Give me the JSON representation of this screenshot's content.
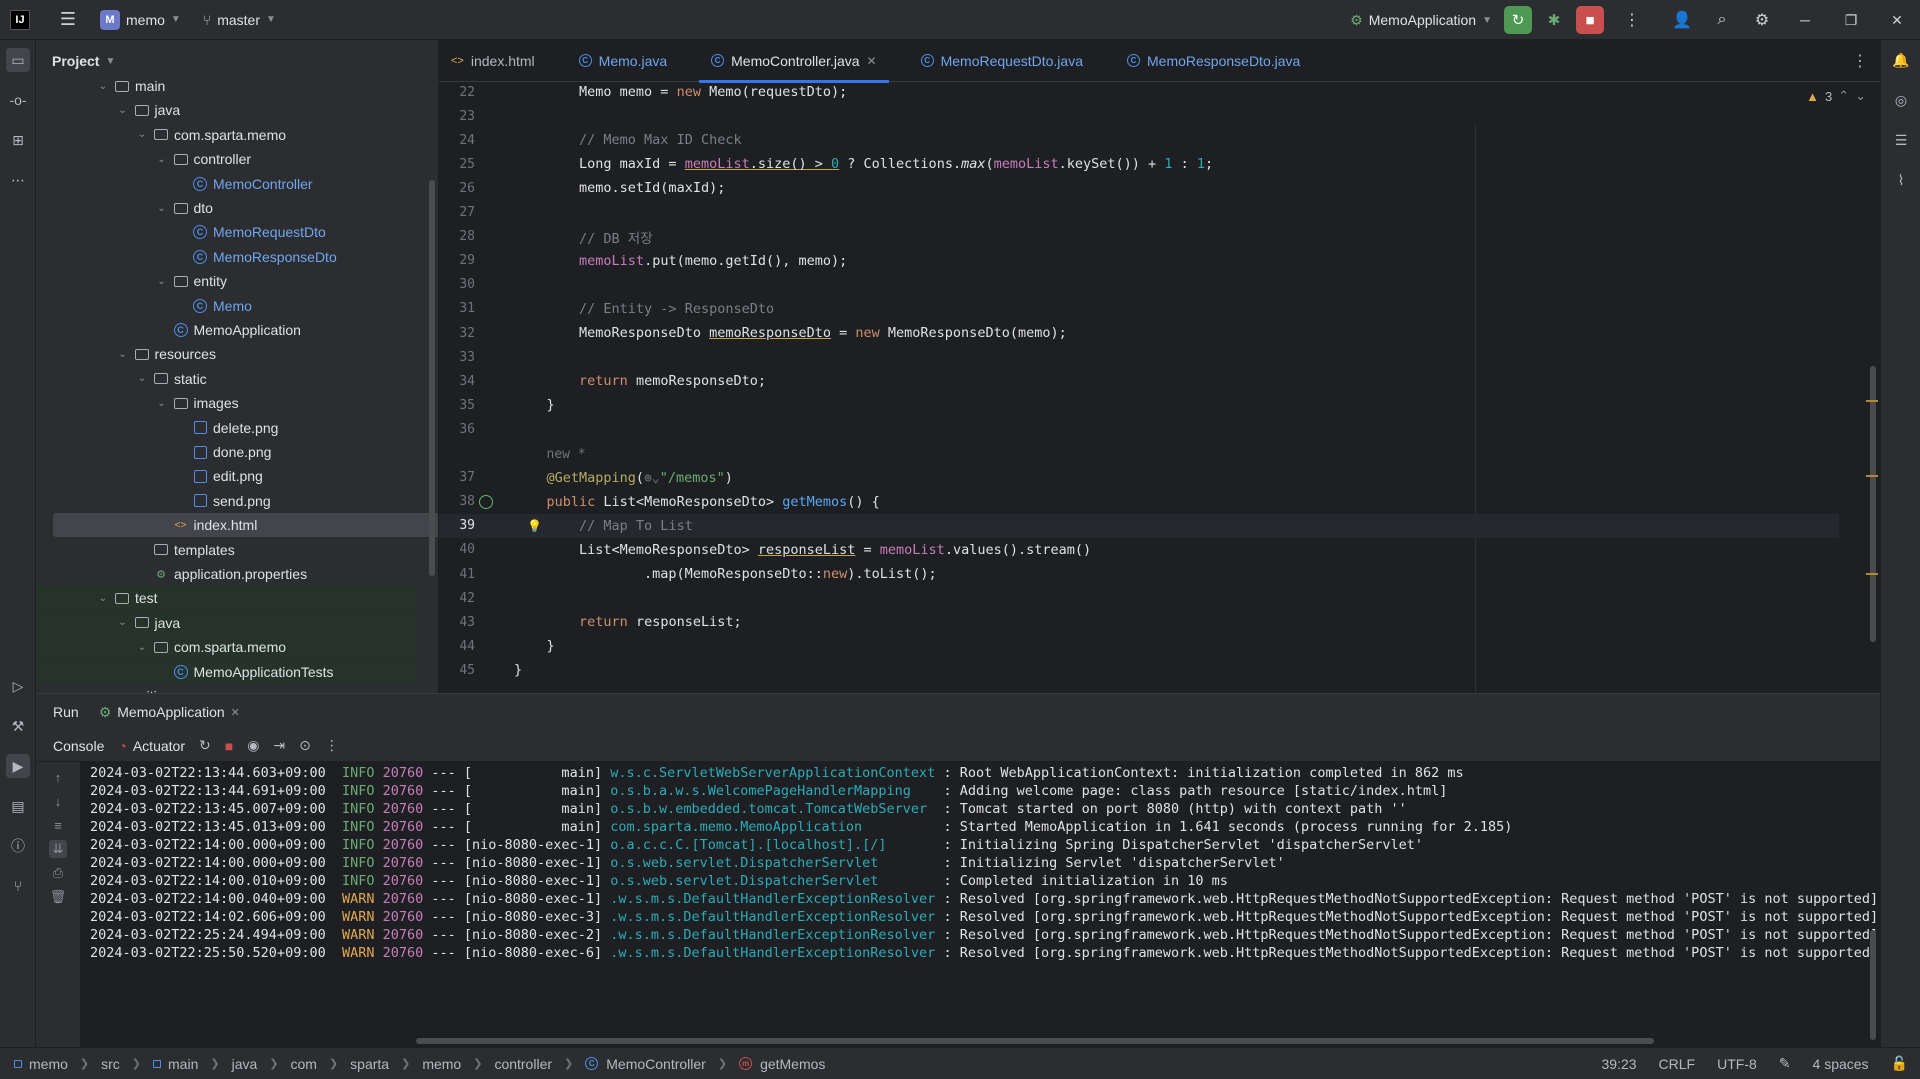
{
  "titlebar": {
    "logo": "IJ",
    "project_badge": "M",
    "project_name": "memo",
    "branch": "master",
    "run_config": "MemoApplication"
  },
  "project_panel": {
    "title": "Project",
    "tree": [
      {
        "label": "main",
        "kind": "folder",
        "indent": 0,
        "open": true
      },
      {
        "label": "java",
        "kind": "folder",
        "indent": 1,
        "open": true
      },
      {
        "label": "com.sparta.memo",
        "kind": "package",
        "indent": 2,
        "open": true
      },
      {
        "label": "controller",
        "kind": "package",
        "indent": 3,
        "open": true
      },
      {
        "label": "MemoController",
        "kind": "class",
        "indent": 4
      },
      {
        "label": "dto",
        "kind": "package",
        "indent": 3,
        "open": true
      },
      {
        "label": "MemoRequestDto",
        "kind": "class",
        "indent": 4
      },
      {
        "label": "MemoResponseDto",
        "kind": "class",
        "indent": 4
      },
      {
        "label": "entity",
        "kind": "package",
        "indent": 3,
        "open": true
      },
      {
        "label": "Memo",
        "kind": "class",
        "indent": 4
      },
      {
        "label": "MemoApplication",
        "kind": "appclass",
        "indent": 3
      },
      {
        "label": "resources",
        "kind": "folder",
        "indent": 1,
        "open": true
      },
      {
        "label": "static",
        "kind": "folder",
        "indent": 2,
        "open": true
      },
      {
        "label": "images",
        "kind": "folder",
        "indent": 3,
        "open": true
      },
      {
        "label": "delete.png",
        "kind": "image",
        "indent": 4
      },
      {
        "label": "done.png",
        "kind": "image",
        "indent": 4
      },
      {
        "label": "edit.png",
        "kind": "image",
        "indent": 4
      },
      {
        "label": "send.png",
        "kind": "image",
        "indent": 4
      },
      {
        "label": "index.html",
        "kind": "html",
        "indent": 3,
        "selected": true
      },
      {
        "label": "templates",
        "kind": "folder",
        "indent": 2
      },
      {
        "label": "application.properties",
        "kind": "props",
        "indent": 2
      },
      {
        "label": "test",
        "kind": "folder",
        "indent": 0,
        "open": true,
        "test": true
      },
      {
        "label": "java",
        "kind": "folder",
        "indent": 1,
        "open": true,
        "test": true
      },
      {
        "label": "com.sparta.memo",
        "kind": "package",
        "indent": 2,
        "open": true,
        "test": true
      },
      {
        "label": "MemoApplicationTests",
        "kind": "class",
        "indent": 3,
        "test": true
      },
      {
        "label": ".gitignore",
        "kind": "file",
        "indent": 0
      }
    ]
  },
  "editor": {
    "tabs": [
      {
        "label": "index.html",
        "kind": "html"
      },
      {
        "label": "Memo.java",
        "kind": "class"
      },
      {
        "label": "MemoController.java",
        "kind": "class",
        "active": true
      },
      {
        "label": "MemoRequestDto.java",
        "kind": "class"
      },
      {
        "label": "MemoResponseDto.java",
        "kind": "class"
      }
    ],
    "warning_count": "3",
    "lines": [
      {
        "n": "22",
        "html": "        <span>Memo memo = </span><span class=\"kw\">new</span><span> Memo(requestDto);</span>"
      },
      {
        "n": "23",
        "html": ""
      },
      {
        "n": "24",
        "html": "        <span class=\"cm\">// Memo Max ID Check</span>"
      },
      {
        "n": "25",
        "html": "        <span>Long maxId = </span><span class=\"fld ul\">memoList</span><span class=\"ul\">.size() &gt; </span><span class=\"num ul\">0</span><span> ? Collections.</span><span class=\"it\">max</span><span>(</span><span class=\"fld\">memoList</span><span>.keySet()) + </span><span class=\"num\">1</span><span> : </span><span class=\"num\">1</span><span>;</span>"
      },
      {
        "n": "26",
        "html": "        <span>memo.setId(maxId);</span>"
      },
      {
        "n": "27",
        "html": ""
      },
      {
        "n": "28",
        "html": "        <span class=\"cm\">// DB 저장</span>"
      },
      {
        "n": "29",
        "html": "        <span class=\"fld\">memoList</span><span>.put(memo.getId(), memo);</span>"
      },
      {
        "n": "30",
        "html": ""
      },
      {
        "n": "31",
        "html": "        <span class=\"cm\">// Entity -&gt; ResponseDto</span>"
      },
      {
        "n": "32",
        "html": "        <span>MemoResponseDto </span><span class=\"ul\">memoResponseDto</span><span> = </span><span class=\"kw\">new</span><span> MemoResponseDto(memo);</span>"
      },
      {
        "n": "33",
        "html": ""
      },
      {
        "n": "34",
        "html": "        <span class=\"kw\">return</span><span> memoResponseDto;</span>"
      },
      {
        "n": "35",
        "html": "    <span>}</span>"
      },
      {
        "n": "36",
        "html": ""
      },
      {
        "n": "",
        "html": "    <span class=\"hint\">new *</span>"
      },
      {
        "n": "37",
        "html": "    <span class=\"ann\">@GetMapping</span><span>(</span><span class=\"hint\">⊕⌄</span><span class=\"str\">\"/memos\"</span><span>)</span>"
      },
      {
        "n": "38",
        "html": "    <span class=\"kw\">public</span><span> List&lt;MemoResponseDto&gt; </span><span class=\"fn\">getMemos</span><span>() {</span>"
      },
      {
        "n": "39",
        "html": "        <span class=\"cm\">// Map To List</span>",
        "current": true
      },
      {
        "n": "40",
        "html": "        <span>List&lt;MemoResponseDto&gt; </span><span class=\"ul\">responseList</span><span> = </span><span class=\"fld\">memoList</span><span>.values().stream()</span>"
      },
      {
        "n": "41",
        "html": "                <span>.map(MemoResponseDto::</span><span class=\"kw\">new</span><span>).toList();</span>"
      },
      {
        "n": "42",
        "html": ""
      },
      {
        "n": "43",
        "html": "        <span class=\"kw\">return</span><span> responseList;</span>"
      },
      {
        "n": "44",
        "html": "    <span>}</span>"
      },
      {
        "n": "45",
        "html": "<span>}</span>"
      }
    ]
  },
  "run_panel": {
    "title": "Run",
    "run_tab": "MemoApplication",
    "console_tab": "Console",
    "actuator_tab": "Actuator",
    "logs": [
      {
        "ts": "2024-03-02T22:13:44.603+09:00",
        "level": "INFO",
        "pid": "20760",
        "thread": "--- [           main]",
        "logger": "w.s.c.ServletWebServerApplicationContext",
        "msg": ": Root WebApplicationContext: initialization completed in 862 ms"
      },
      {
        "ts": "2024-03-02T22:13:44.691+09:00",
        "level": "INFO",
        "pid": "20760",
        "thread": "--- [           main]",
        "logger": "o.s.b.a.w.s.WelcomePageHandlerMapping   ",
        "msg": ": Adding welcome page: class path resource [static/index.html]"
      },
      {
        "ts": "2024-03-02T22:13:45.007+09:00",
        "level": "INFO",
        "pid": "20760",
        "thread": "--- [           main]",
        "logger": "o.s.b.w.embedded.tomcat.TomcatWebServer ",
        "msg": ": Tomcat started on port 8080 (http) with context path ''"
      },
      {
        "ts": "2024-03-02T22:13:45.013+09:00",
        "level": "INFO",
        "pid": "20760",
        "thread": "--- [           main]",
        "logger": "com.sparta.memo.MemoApplication         ",
        "msg": ": Started MemoApplication in 1.641 seconds (process running for 2.185)"
      },
      {
        "ts": "2024-03-02T22:14:00.000+09:00",
        "level": "INFO",
        "pid": "20760",
        "thread": "--- [nio-8080-exec-1]",
        "logger": "o.a.c.c.C.[Tomcat].[localhost].[/]      ",
        "msg": ": Initializing Spring DispatcherServlet 'dispatcherServlet'"
      },
      {
        "ts": "2024-03-02T22:14:00.000+09:00",
        "level": "INFO",
        "pid": "20760",
        "thread": "--- [nio-8080-exec-1]",
        "logger": "o.s.web.servlet.DispatcherServlet       ",
        "msg": ": Initializing Servlet 'dispatcherServlet'"
      },
      {
        "ts": "2024-03-02T22:14:00.010+09:00",
        "level": "INFO",
        "pid": "20760",
        "thread": "--- [nio-8080-exec-1]",
        "logger": "o.s.web.servlet.DispatcherServlet       ",
        "msg": ": Completed initialization in 10 ms"
      },
      {
        "ts": "2024-03-02T22:14:00.040+09:00",
        "level": "WARN",
        "pid": "20760",
        "thread": "--- [nio-8080-exec-1]",
        "logger": ".w.s.m.s.DefaultHandlerExceptionResolver",
        "msg": ": Resolved [org.springframework.web.HttpRequestMethodNotSupportedException: Request method 'POST' is not supported]"
      },
      {
        "ts": "2024-03-02T22:14:02.606+09:00",
        "level": "WARN",
        "pid": "20760",
        "thread": "--- [nio-8080-exec-3]",
        "logger": ".w.s.m.s.DefaultHandlerExceptionResolver",
        "msg": ": Resolved [org.springframework.web.HttpRequestMethodNotSupportedException: Request method 'POST' is not supported]"
      },
      {
        "ts": "2024-03-02T22:25:24.494+09:00",
        "level": "WARN",
        "pid": "20760",
        "thread": "--- [nio-8080-exec-2]",
        "logger": ".w.s.m.s.DefaultHandlerExceptionResolver",
        "msg": ": Resolved [org.springframework.web.HttpRequestMethodNotSupportedException: Request method 'POST' is not supported]"
      },
      {
        "ts": "2024-03-02T22:25:50.520+09:00",
        "level": "WARN",
        "pid": "20760",
        "thread": "--- [nio-8080-exec-6]",
        "logger": ".w.s.m.s.DefaultHandlerExceptionResolver",
        "msg": ": Resolved [org.springframework.web.HttpRequestMethodNotSupportedException: Request method 'POST' is not supported]"
      }
    ]
  },
  "statusbar": {
    "breadcrumbs": [
      "memo",
      "src",
      "main",
      "java",
      "com",
      "sparta",
      "memo",
      "controller",
      "MemoController",
      "getMemos"
    ],
    "position": "39:23",
    "line_sep": "CRLF",
    "encoding": "UTF-8",
    "indent": "4 spaces"
  },
  "colors": {
    "accent": "#3574f0",
    "run_green": "#4e9a54",
    "stop_red": "#c94f4f"
  }
}
